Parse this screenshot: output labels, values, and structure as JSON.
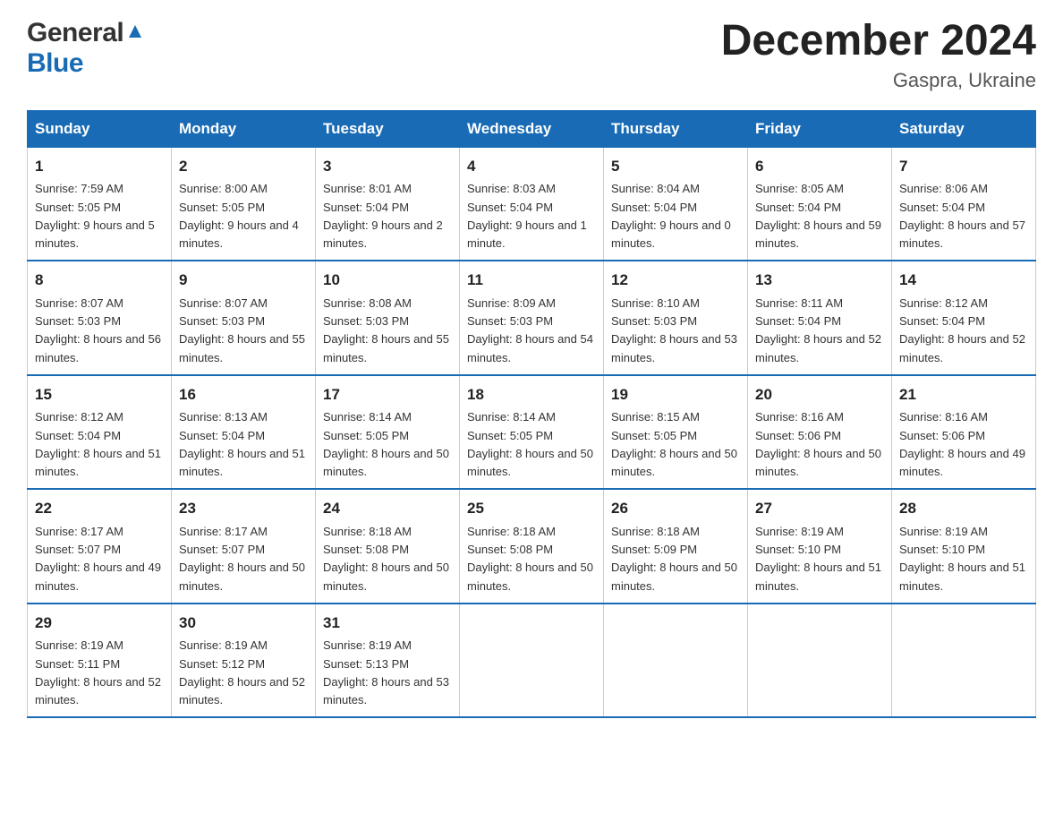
{
  "logo": {
    "general": "General",
    "blue": "Blue"
  },
  "title": "December 2024",
  "location": "Gaspra, Ukraine",
  "days_of_week": [
    "Sunday",
    "Monday",
    "Tuesday",
    "Wednesday",
    "Thursday",
    "Friday",
    "Saturday"
  ],
  "weeks": [
    [
      {
        "num": "1",
        "sunrise": "7:59 AM",
        "sunset": "5:05 PM",
        "daylight": "9 hours and 5 minutes."
      },
      {
        "num": "2",
        "sunrise": "8:00 AM",
        "sunset": "5:05 PM",
        "daylight": "9 hours and 4 minutes."
      },
      {
        "num": "3",
        "sunrise": "8:01 AM",
        "sunset": "5:04 PM",
        "daylight": "9 hours and 2 minutes."
      },
      {
        "num": "4",
        "sunrise": "8:03 AM",
        "sunset": "5:04 PM",
        "daylight": "9 hours and 1 minute."
      },
      {
        "num": "5",
        "sunrise": "8:04 AM",
        "sunset": "5:04 PM",
        "daylight": "9 hours and 0 minutes."
      },
      {
        "num": "6",
        "sunrise": "8:05 AM",
        "sunset": "5:04 PM",
        "daylight": "8 hours and 59 minutes."
      },
      {
        "num": "7",
        "sunrise": "8:06 AM",
        "sunset": "5:04 PM",
        "daylight": "8 hours and 57 minutes."
      }
    ],
    [
      {
        "num": "8",
        "sunrise": "8:07 AM",
        "sunset": "5:03 PM",
        "daylight": "8 hours and 56 minutes."
      },
      {
        "num": "9",
        "sunrise": "8:07 AM",
        "sunset": "5:03 PM",
        "daylight": "8 hours and 55 minutes."
      },
      {
        "num": "10",
        "sunrise": "8:08 AM",
        "sunset": "5:03 PM",
        "daylight": "8 hours and 55 minutes."
      },
      {
        "num": "11",
        "sunrise": "8:09 AM",
        "sunset": "5:03 PM",
        "daylight": "8 hours and 54 minutes."
      },
      {
        "num": "12",
        "sunrise": "8:10 AM",
        "sunset": "5:03 PM",
        "daylight": "8 hours and 53 minutes."
      },
      {
        "num": "13",
        "sunrise": "8:11 AM",
        "sunset": "5:04 PM",
        "daylight": "8 hours and 52 minutes."
      },
      {
        "num": "14",
        "sunrise": "8:12 AM",
        "sunset": "5:04 PM",
        "daylight": "8 hours and 52 minutes."
      }
    ],
    [
      {
        "num": "15",
        "sunrise": "8:12 AM",
        "sunset": "5:04 PM",
        "daylight": "8 hours and 51 minutes."
      },
      {
        "num": "16",
        "sunrise": "8:13 AM",
        "sunset": "5:04 PM",
        "daylight": "8 hours and 51 minutes."
      },
      {
        "num": "17",
        "sunrise": "8:14 AM",
        "sunset": "5:05 PM",
        "daylight": "8 hours and 50 minutes."
      },
      {
        "num": "18",
        "sunrise": "8:14 AM",
        "sunset": "5:05 PM",
        "daylight": "8 hours and 50 minutes."
      },
      {
        "num": "19",
        "sunrise": "8:15 AM",
        "sunset": "5:05 PM",
        "daylight": "8 hours and 50 minutes."
      },
      {
        "num": "20",
        "sunrise": "8:16 AM",
        "sunset": "5:06 PM",
        "daylight": "8 hours and 50 minutes."
      },
      {
        "num": "21",
        "sunrise": "8:16 AM",
        "sunset": "5:06 PM",
        "daylight": "8 hours and 49 minutes."
      }
    ],
    [
      {
        "num": "22",
        "sunrise": "8:17 AM",
        "sunset": "5:07 PM",
        "daylight": "8 hours and 49 minutes."
      },
      {
        "num": "23",
        "sunrise": "8:17 AM",
        "sunset": "5:07 PM",
        "daylight": "8 hours and 50 minutes."
      },
      {
        "num": "24",
        "sunrise": "8:18 AM",
        "sunset": "5:08 PM",
        "daylight": "8 hours and 50 minutes."
      },
      {
        "num": "25",
        "sunrise": "8:18 AM",
        "sunset": "5:08 PM",
        "daylight": "8 hours and 50 minutes."
      },
      {
        "num": "26",
        "sunrise": "8:18 AM",
        "sunset": "5:09 PM",
        "daylight": "8 hours and 50 minutes."
      },
      {
        "num": "27",
        "sunrise": "8:19 AM",
        "sunset": "5:10 PM",
        "daylight": "8 hours and 51 minutes."
      },
      {
        "num": "28",
        "sunrise": "8:19 AM",
        "sunset": "5:10 PM",
        "daylight": "8 hours and 51 minutes."
      }
    ],
    [
      {
        "num": "29",
        "sunrise": "8:19 AM",
        "sunset": "5:11 PM",
        "daylight": "8 hours and 52 minutes."
      },
      {
        "num": "30",
        "sunrise": "8:19 AM",
        "sunset": "5:12 PM",
        "daylight": "8 hours and 52 minutes."
      },
      {
        "num": "31",
        "sunrise": "8:19 AM",
        "sunset": "5:13 PM",
        "daylight": "8 hours and 53 minutes."
      },
      {
        "num": "",
        "sunrise": "",
        "sunset": "",
        "daylight": ""
      },
      {
        "num": "",
        "sunrise": "",
        "sunset": "",
        "daylight": ""
      },
      {
        "num": "",
        "sunrise": "",
        "sunset": "",
        "daylight": ""
      },
      {
        "num": "",
        "sunrise": "",
        "sunset": "",
        "daylight": ""
      }
    ]
  ],
  "labels": {
    "sunrise": "Sunrise:",
    "sunset": "Sunset:",
    "daylight": "Daylight:"
  }
}
